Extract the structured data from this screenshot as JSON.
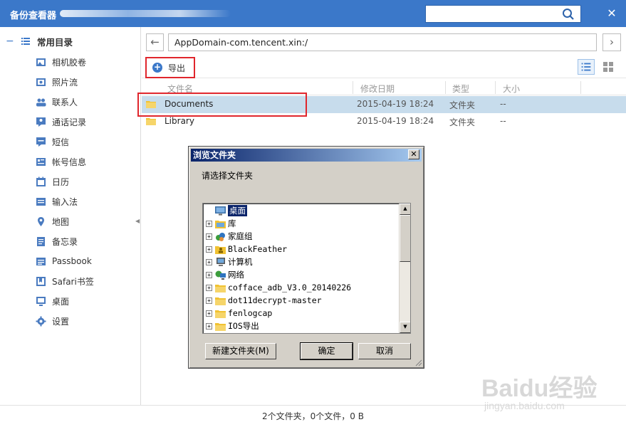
{
  "titlebar": {
    "title": "备份查看器",
    "search_placeholder": "",
    "close_label": "✕"
  },
  "sidebar": {
    "group_label": "常用目录",
    "items": [
      {
        "label": "相机胶卷",
        "icon": "camera-roll-icon"
      },
      {
        "label": "照片流",
        "icon": "photo-stream-icon"
      },
      {
        "label": "联系人",
        "icon": "contacts-icon"
      },
      {
        "label": "通话记录",
        "icon": "call-log-icon"
      },
      {
        "label": "短信",
        "icon": "sms-icon"
      },
      {
        "label": "帐号信息",
        "icon": "account-icon"
      },
      {
        "label": "日历",
        "icon": "calendar-icon"
      },
      {
        "label": "输入法",
        "icon": "keyboard-icon"
      },
      {
        "label": "地图",
        "icon": "map-pin-icon"
      },
      {
        "label": "备忘录",
        "icon": "notes-icon"
      },
      {
        "label": "Passbook",
        "icon": "passbook-icon"
      },
      {
        "label": "Safari书签",
        "icon": "bookmark-icon"
      },
      {
        "label": "桌面",
        "icon": "desktop-icon"
      },
      {
        "label": "设置",
        "icon": "gear-icon"
      }
    ]
  },
  "main": {
    "address": "AppDomain-com.tencent.xin:/",
    "export_label": "导出",
    "columns": [
      "文件名",
      "修改日期",
      "类型",
      "大小"
    ],
    "rows": [
      {
        "name": "Documents",
        "date": "2015-04-19 18:24",
        "type": "文件夹",
        "size": "--"
      },
      {
        "name": "Library",
        "date": "2015-04-19 18:24",
        "type": "文件夹",
        "size": "--"
      }
    ]
  },
  "status": {
    "text": "2个文件夹，0个文件，0 B"
  },
  "dialog": {
    "title": "浏览文件夹",
    "close_label": "✕",
    "prompt": "请选择文件夹",
    "tree": [
      {
        "label": "桌面",
        "icon": "desktop-icon",
        "expandable": false,
        "selected": true
      },
      {
        "label": "库",
        "icon": "library-icon",
        "expandable": true
      },
      {
        "label": "家庭组",
        "icon": "homegroup-icon",
        "expandable": true
      },
      {
        "label": "BlackFeather",
        "icon": "user-folder-icon",
        "expandable": true
      },
      {
        "label": "计算机",
        "icon": "computer-icon",
        "expandable": true
      },
      {
        "label": "网络",
        "icon": "network-icon",
        "expandable": true
      },
      {
        "label": "cofface_adb_V3.0_20140226",
        "icon": "folder-icon",
        "expandable": true
      },
      {
        "label": "dot11decrypt-master",
        "icon": "folder-icon",
        "expandable": true
      },
      {
        "label": "fenlogcap",
        "icon": "folder-icon",
        "expandable": true
      },
      {
        "label": "IOS导出",
        "icon": "folder-icon",
        "expandable": true
      }
    ],
    "buttons": {
      "new_folder": "新建文件夹(M)",
      "ok": "确定",
      "cancel": "取消"
    }
  },
  "watermark": {
    "brand": "Baidu经验",
    "url": "jingyan.baidu.com"
  },
  "colors": {
    "accent": "#3b78c9",
    "highlight": "#e0262c",
    "selected_row": "#c7dcec"
  }
}
